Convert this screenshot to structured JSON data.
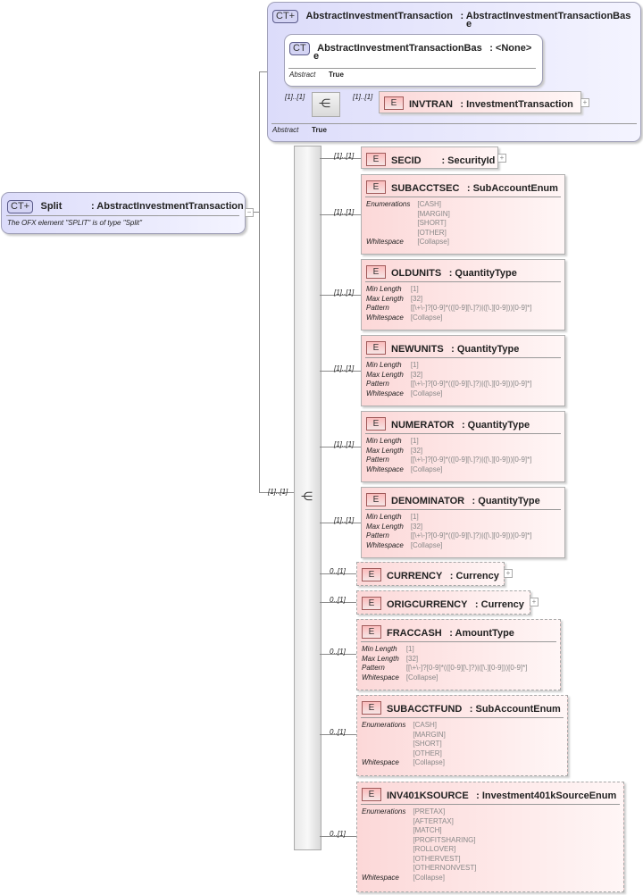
{
  "split": {
    "name": "Split",
    "type": ": AbstractInvestmentTransaction",
    "description": "The OFX element \"SPLIT\" is of type \"Split\"",
    "badge": "CT+"
  },
  "abstract_tx": {
    "name": "AbstractInvestmentTransaction",
    "type": ": AbstractInvestmentTransactionBas",
    "type_wrap": "e",
    "badge": "CT+",
    "abstract_label": "Abstract",
    "abstract_value": "True",
    "base": {
      "name": "AbstractInvestmentTransactionBas",
      "name_wrap": "e",
      "type": ": <None>",
      "badge": "CT",
      "abstract_label": "Abstract",
      "abstract_value": "True"
    },
    "seq_card": "[1]..[1]",
    "invtran": {
      "card": "[1]..[1]",
      "name": "INVTRAN",
      "type": ": InvestmentTransaction",
      "badge": "E"
    }
  },
  "main_seq_card": "[1]..[1]",
  "elements": [
    {
      "card": "[1]..[1]",
      "name": "SECID",
      "type": ": SecurityId",
      "optional": false,
      "expandable": true,
      "facets": []
    },
    {
      "card": "[1]..[1]",
      "name": "SUBACCTSEC",
      "type": ": SubAccountEnum",
      "optional": false,
      "facets": [
        {
          "label": "Enumerations",
          "values": [
            "[CASH]",
            "[MARGIN]",
            "[SHORT]",
            "[OTHER]"
          ]
        },
        {
          "label": "Whitespace",
          "values": [
            "[Collapse]"
          ]
        }
      ]
    },
    {
      "card": "[1]..[1]",
      "name": "OLDUNITS",
      "type": ": QuantityType",
      "optional": false,
      "facets": [
        {
          "label": "Min Length",
          "values": [
            "[1]"
          ]
        },
        {
          "label": "Max Length",
          "values": [
            "[32]"
          ]
        },
        {
          "label": "Pattern",
          "values": [
            "[[\\+\\-]?[0-9]*(([0-9][\\.]?)|([\\.][0-9]))[0-9]*]"
          ]
        },
        {
          "label": "Whitespace",
          "values": [
            "[Collapse]"
          ]
        }
      ]
    },
    {
      "card": "[1]..[1]",
      "name": "NEWUNITS",
      "type": ": QuantityType",
      "optional": false,
      "facets": [
        {
          "label": "Min Length",
          "values": [
            "[1]"
          ]
        },
        {
          "label": "Max Length",
          "values": [
            "[32]"
          ]
        },
        {
          "label": "Pattern",
          "values": [
            "[[\\+\\-]?[0-9]*(([0-9][\\.]?)|([\\.][0-9]))[0-9]*]"
          ]
        },
        {
          "label": "Whitespace",
          "values": [
            "[Collapse]"
          ]
        }
      ]
    },
    {
      "card": "[1]..[1]",
      "name": "NUMERATOR",
      "type": ": QuantityType",
      "optional": false,
      "facets": [
        {
          "label": "Min Length",
          "values": [
            "[1]"
          ]
        },
        {
          "label": "Max Length",
          "values": [
            "[32]"
          ]
        },
        {
          "label": "Pattern",
          "values": [
            "[[\\+\\-]?[0-9]*(([0-9][\\.]?)|([\\.][0-9]))[0-9]*]"
          ]
        },
        {
          "label": "Whitespace",
          "values": [
            "[Collapse]"
          ]
        }
      ]
    },
    {
      "card": "[1]..[1]",
      "name": "DENOMINATOR",
      "type": ": QuantityType",
      "optional": false,
      "facets": [
        {
          "label": "Min Length",
          "values": [
            "[1]"
          ]
        },
        {
          "label": "Max Length",
          "values": [
            "[32]"
          ]
        },
        {
          "label": "Pattern",
          "values": [
            "[[\\+\\-]?[0-9]*(([0-9][\\.]?)|([\\.][0-9]))[0-9]*]"
          ]
        },
        {
          "label": "Whitespace",
          "values": [
            "[Collapse]"
          ]
        }
      ]
    },
    {
      "card": "0..[1]",
      "name": "CURRENCY",
      "type": ": Currency",
      "optional": true,
      "expandable": true,
      "facets": []
    },
    {
      "card": "0..[1]",
      "name": "ORIGCURRENCY",
      "type": ": Currency",
      "optional": true,
      "expandable": true,
      "facets": []
    },
    {
      "card": "0..[1]",
      "name": "FRACCASH",
      "type": ": AmountType",
      "optional": true,
      "facets": [
        {
          "label": "Min Length",
          "values": [
            "[1]"
          ]
        },
        {
          "label": "Max Length",
          "values": [
            "[32]"
          ]
        },
        {
          "label": "Pattern",
          "values": [
            "[[\\+\\-]?[0-9]*(([0-9][\\.]?)|([\\.][0-9]))[0-9]*]"
          ]
        },
        {
          "label": "Whitespace",
          "values": [
            "[Collapse]"
          ]
        }
      ]
    },
    {
      "card": "0..[1]",
      "name": "SUBACCTFUND",
      "type": ": SubAccountEnum",
      "optional": true,
      "facets": [
        {
          "label": "Enumerations",
          "values": [
            "[CASH]",
            "[MARGIN]",
            "[SHORT]",
            "[OTHER]"
          ]
        },
        {
          "label": "Whitespace",
          "values": [
            "[Collapse]"
          ]
        }
      ]
    },
    {
      "card": "0..[1]",
      "name": "INV401KSOURCE",
      "type": ": Investment401kSourceEnum",
      "optional": true,
      "facets": [
        {
          "label": "Enumerations",
          "values": [
            "[PRETAX]",
            "[AFTERTAX]",
            "[MATCH]",
            "[PROFITSHARING]",
            "[ROLLOVER]",
            "[OTHERVEST]",
            "[OTHERNONVEST]"
          ]
        },
        {
          "label": "Whitespace",
          "values": [
            "[Collapse]"
          ]
        }
      ]
    }
  ]
}
